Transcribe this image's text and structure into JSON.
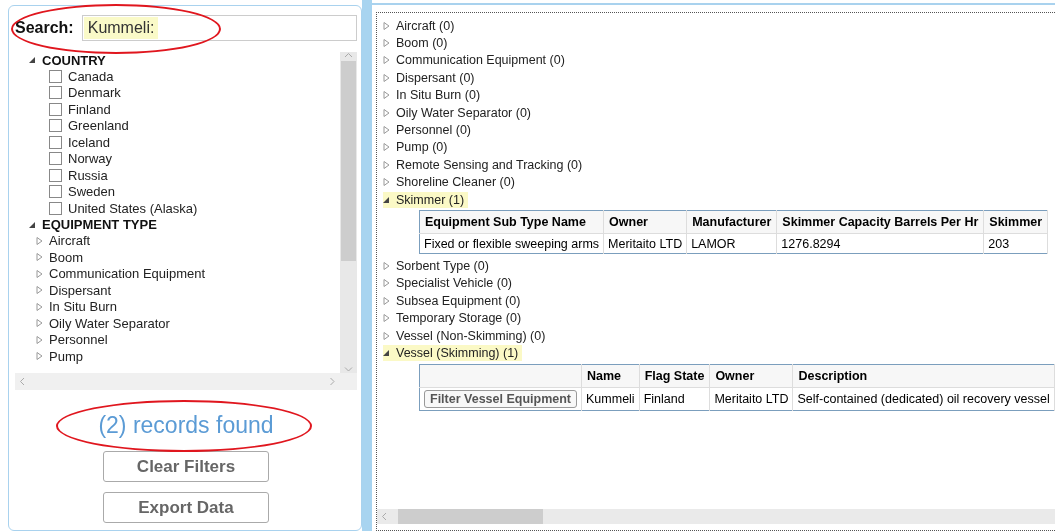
{
  "search": {
    "label": "Search:",
    "value": "Kummeli:"
  },
  "filters": [
    {
      "label": "COUNTRY",
      "kind": "checkbox",
      "expanded": true,
      "items": [
        {
          "label": "Canada",
          "checked": false
        },
        {
          "label": "Denmark",
          "checked": false
        },
        {
          "label": "Finland",
          "checked": false
        },
        {
          "label": "Greenland",
          "checked": false
        },
        {
          "label": "Iceland",
          "checked": false
        },
        {
          "label": "Norway",
          "checked": false
        },
        {
          "label": "Russia",
          "checked": false
        },
        {
          "label": "Sweden",
          "checked": false
        },
        {
          "label": "United States (Alaska)",
          "checked": false
        }
      ]
    },
    {
      "label": "EQUIPMENT TYPE",
      "kind": "node",
      "expanded": true,
      "items": [
        {
          "label": "Aircraft",
          "expanded": false
        },
        {
          "label": "Boom",
          "expanded": false
        },
        {
          "label": "Communication Equipment",
          "expanded": false
        },
        {
          "label": "Dispersant",
          "expanded": false
        },
        {
          "label": "In Situ Burn",
          "expanded": false
        },
        {
          "label": "Oily Water Separator",
          "expanded": false
        },
        {
          "label": "Personnel",
          "expanded": false
        },
        {
          "label": "Pump",
          "expanded": false
        }
      ]
    }
  ],
  "records_found": "(2) records found",
  "buttons": [
    "Clear Filters",
    "Export Data"
  ],
  "results": [
    {
      "label": "Aircraft (0)",
      "expanded": false
    },
    {
      "label": "Boom (0)",
      "expanded": false
    },
    {
      "label": "Communication Equipment (0)",
      "expanded": false
    },
    {
      "label": "Dispersant (0)",
      "expanded": false
    },
    {
      "label": "In Situ Burn (0)",
      "expanded": false
    },
    {
      "label": "Oily Water Separator (0)",
      "expanded": false
    },
    {
      "label": "Personnel (0)",
      "expanded": false
    },
    {
      "label": "Pump (0)",
      "expanded": false
    },
    {
      "label": "Remote Sensing and Tracking (0)",
      "expanded": false
    },
    {
      "label": "Shoreline Cleaner (0)",
      "expanded": false
    },
    {
      "label": "Skimmer (1)",
      "expanded": true,
      "table": {
        "columns": [
          "Equipment Sub Type Name",
          "Owner",
          "Manufacturer",
          "Skimmer Capacity Barrels Per Hr",
          "Skimmer"
        ],
        "rows": [
          {
            "cells": [
              "Fixed or flexible sweeping arms",
              "Meritaito LTD",
              "LAMOR",
              "1276.8294",
              "203"
            ]
          }
        ]
      }
    },
    {
      "label": "Sorbent Type (0)",
      "expanded": false
    },
    {
      "label": "Specialist Vehicle (0)",
      "expanded": false
    },
    {
      "label": "Subsea Equipment (0)",
      "expanded": false
    },
    {
      "label": "Temporary Storage (0)",
      "expanded": false
    },
    {
      "label": "Vessel (Non-Skimming) (0)",
      "expanded": false
    },
    {
      "label": "Vessel (Skimming) (1)",
      "expanded": true,
      "table": {
        "columns": [
          "Name",
          "Flag State",
          "Owner",
          "Description"
        ],
        "rows": [
          {
            "action": "Filter Vessel Equipment",
            "cells": [
              "Kummeli",
              "Finland",
              "Meritaito LTD",
              "Self-contained (dedicated) oil recovery vessel"
            ]
          }
        ]
      }
    }
  ]
}
